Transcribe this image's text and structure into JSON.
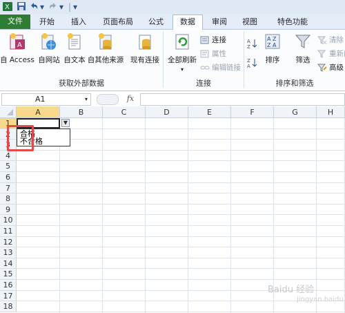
{
  "qat": {
    "save_icon": "save-icon",
    "undo_icon": "undo-icon",
    "redo_icon": "redo-icon",
    "sep": "|",
    "down": "▾"
  },
  "tabs": [
    {
      "label": "文件"
    },
    {
      "label": "开始"
    },
    {
      "label": "插入"
    },
    {
      "label": "页面布局"
    },
    {
      "label": "公式"
    },
    {
      "label": "数据"
    },
    {
      "label": "审阅"
    },
    {
      "label": "视图"
    },
    {
      "label": "特色功能"
    }
  ],
  "ribbon": {
    "external": {
      "label": "获取外部数据",
      "buttons": [
        {
          "label": "自 Access"
        },
        {
          "label": "自网站"
        },
        {
          "label": "自文本"
        },
        {
          "label": "自其他来源"
        },
        {
          "label": "现有连接"
        }
      ]
    },
    "connections": {
      "label": "连接",
      "refresh_all": "全部刷新",
      "connections": "连接",
      "properties": "属性",
      "edit_links": "编辑链接"
    },
    "sort_filter": {
      "label": "排序和筛选",
      "sort": "排序",
      "filter": "筛选",
      "clear": "清除",
      "reapply": "重新应",
      "advanced": "高级",
      "az": "A Z",
      "za": "Z A"
    }
  },
  "formula_bar": {
    "name_box": "A1",
    "fx": "fx",
    "content": ""
  },
  "grid": {
    "columns": [
      "A",
      "B",
      "C",
      "D",
      "E",
      "F",
      "G",
      "H"
    ],
    "rows": [
      "1",
      "2",
      "3",
      "4",
      "5",
      "6",
      "7",
      "8",
      "9",
      "10",
      "11",
      "12",
      "13",
      "14",
      "15",
      "16",
      "17",
      "18"
    ],
    "selected_cell": "A1",
    "dropdown_options": [
      "合格",
      "不合格"
    ]
  },
  "watermark": {
    "text": "Baidu 经验",
    "sub": "jingyan.baidu.com"
  }
}
